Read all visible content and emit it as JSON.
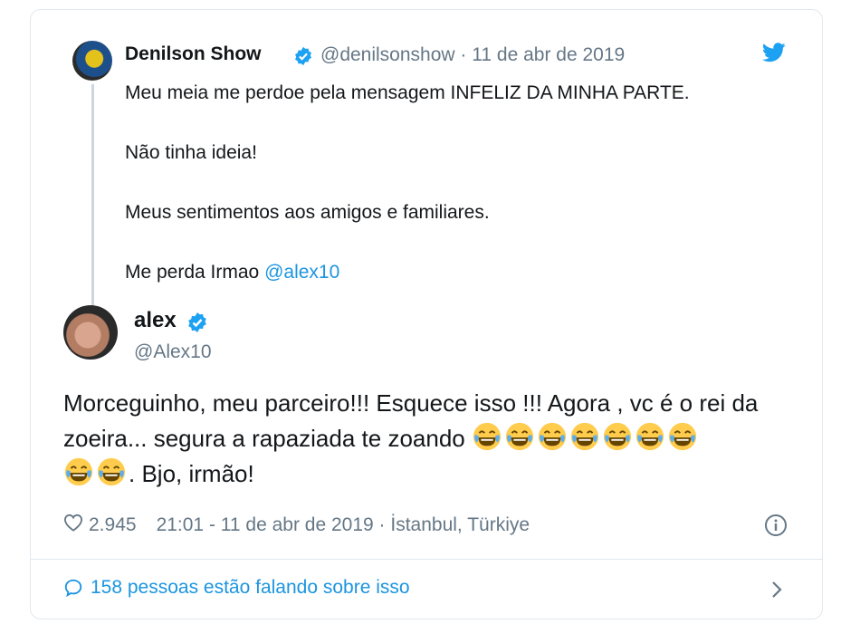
{
  "quoted_tweet": {
    "name": "Denilson Show",
    "handle": "@denilsonshow",
    "separator": "·",
    "date": "11 de abr de 2019",
    "lines": [
      "Meu meia me perdoe pela mensagem INFELIZ DA MINHA PARTE.",
      "Não tinha ideia!",
      "Meus sentimentos aos amigos e familiares."
    ],
    "last_line_text": "Me perda Irmao ",
    "last_line_link": "@alex10"
  },
  "main_tweet": {
    "name": "alex",
    "handle": "@Alex10",
    "text_part1": "Morceguinho, meu parceiro!!! Esquece isso !!! Agora , vc é o rei da zoeira... segura a rapaziada te zoando ",
    "text_part2": ". Bjo, irmão!",
    "emoji_count_line1": 7,
    "emoji_count_line2": 2,
    "likes": "2.945",
    "timestamp": "21:01 - 11 de abr de 2019 · İstanbul, Türkiye"
  },
  "footer": {
    "label": "158 pessoas estão falando sobre isso"
  },
  "icons": [
    "verified-badge-icon",
    "twitter-bird-icon",
    "heart-icon",
    "info-icon",
    "comment-icon",
    "chevron-right-icon",
    "laughing-emoji-icon"
  ],
  "colors": {
    "link": "#1b95e0",
    "verified": "#1da1f2",
    "muted": "#657786",
    "border": "#e1e8ed"
  }
}
